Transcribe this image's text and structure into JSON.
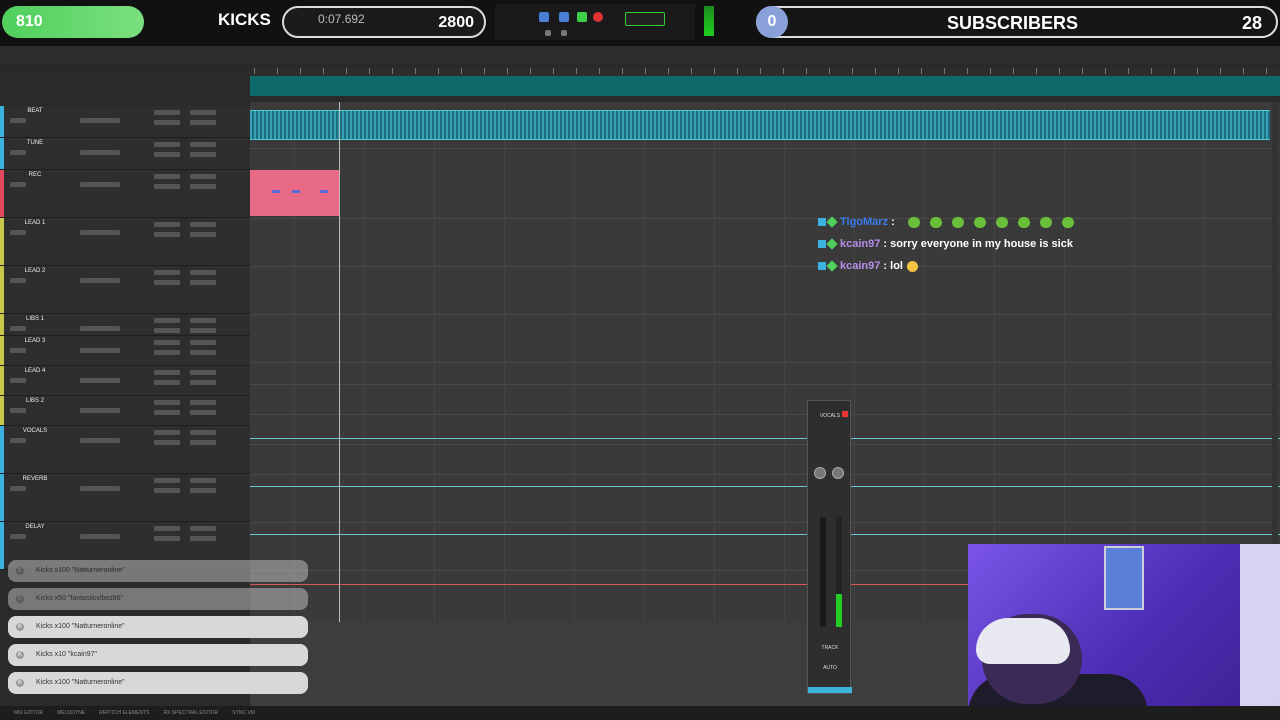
{
  "stream": {
    "goal_left_count": "810",
    "goal_label": "KICKS",
    "counter_time": "0:07.692",
    "goal_target": "2800",
    "subs_current": "0",
    "subs_label": "SUBSCRIBERS",
    "subs_target": "28"
  },
  "chat": [
    {
      "user": "TigoMarz",
      "message": "",
      "emotes": 8
    },
    {
      "user": "kcain97",
      "message": "sorry everyone in my house is sick"
    },
    {
      "user": "kcain97",
      "message": "lol"
    }
  ],
  "tracks": [
    {
      "name": "BEAT",
      "color": "#3bb3e0"
    },
    {
      "name": "TUNE",
      "color": "#3bb3e0"
    },
    {
      "name": "REC",
      "color": "#e24a5e"
    },
    {
      "name": "LEAD 1",
      "color": "#c8c84a"
    },
    {
      "name": "LEAD 2",
      "color": "#c8c84a"
    },
    {
      "name": "LIBS 1",
      "color": "#c8c84a"
    },
    {
      "name": "LEAD 3",
      "color": "#c8c84a"
    },
    {
      "name": "LEAD 4",
      "color": "#c8c84a"
    },
    {
      "name": "LIBS 2",
      "color": "#c8c84a"
    },
    {
      "name": "VOCALS",
      "color": "#3bb3e0"
    },
    {
      "name": "REVERB",
      "color": "#3bb3e0"
    },
    {
      "name": "DELAY",
      "color": "#3bb3e0"
    }
  ],
  "alerts": [
    {
      "text": "Kicks x100 \"Natturneronline\"",
      "dim": true
    },
    {
      "text": "Kicks x50 \"fantasticvibez86\"",
      "dim": true
    },
    {
      "text": "Kicks x100 \"Natturneronline\"",
      "dim": false
    },
    {
      "text": "Kicks x10 \"kcain97\"",
      "dim": false
    },
    {
      "text": "Kicks x100 \"Natturneronline\"",
      "dim": false
    }
  ],
  "mixer": {
    "track_label": "VOCALS",
    "mode_label": "TRACK",
    "auto_label": "AUTO"
  },
  "bottombar": [
    "MIX EDITOR",
    "MELODYNE",
    "REPITCH ELEMENTS",
    "RX SPECTRAL EDITOR",
    "SYNC VM"
  ],
  "colors": {
    "goal_green": "#4fcf5c",
    "waveform": "#3aa0b5",
    "rec_clip": "#e86a86",
    "cam_purple": "#6a45d8"
  }
}
